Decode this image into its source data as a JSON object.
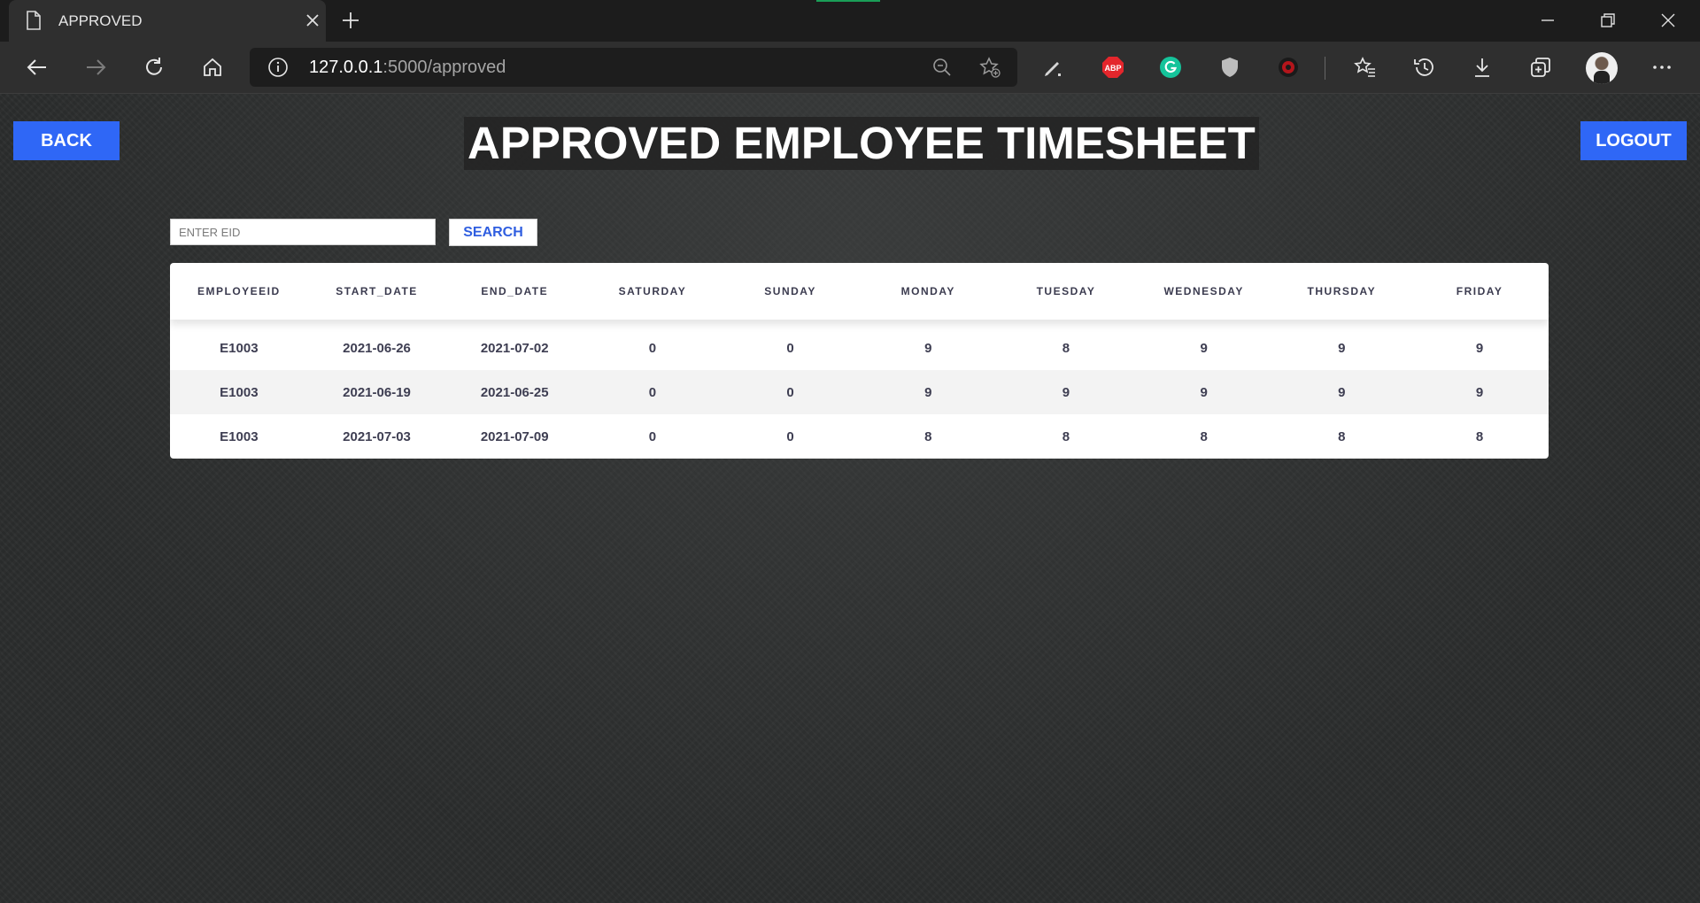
{
  "browser": {
    "tab_title": "APPROVED",
    "url_host": "127.0.0.1",
    "url_rest": ":5000/approved",
    "extensions": [
      "pen-icon",
      "abp-icon",
      "grammarly-icon",
      "shield-icon",
      "record-icon"
    ],
    "colors": {
      "tabbar": "#1c1c1c",
      "toolbar": "#2f2f2f",
      "omnibox": "#1d1d1d",
      "abp": "#e4262c",
      "grammarly": "#15c39a"
    }
  },
  "header": {
    "back_label": "BACK",
    "title": "APPROVED EMPLOYEE TIMESHEET",
    "logout_label": "LOGOUT",
    "accent": "#2f67f6"
  },
  "search": {
    "placeholder": "ENTER EID",
    "value": "",
    "button_label": "SEARCH"
  },
  "table": {
    "columns": [
      "EMPLOYEEID",
      "START_DATE",
      "END_DATE",
      "SATURDAY",
      "SUNDAY",
      "MONDAY",
      "TUESDAY",
      "WEDNESDAY",
      "THURSDAY",
      "FRIDAY"
    ],
    "rows": [
      [
        "E1003",
        "2021-06-26",
        "2021-07-02",
        "0",
        "0",
        "9",
        "8",
        "9",
        "9",
        "9"
      ],
      [
        "E1003",
        "2021-06-19",
        "2021-06-25",
        "0",
        "0",
        "9",
        "9",
        "9",
        "9",
        "9"
      ],
      [
        "E1003",
        "2021-07-03",
        "2021-07-09",
        "0",
        "0",
        "8",
        "8",
        "8",
        "8",
        "8"
      ]
    ]
  }
}
